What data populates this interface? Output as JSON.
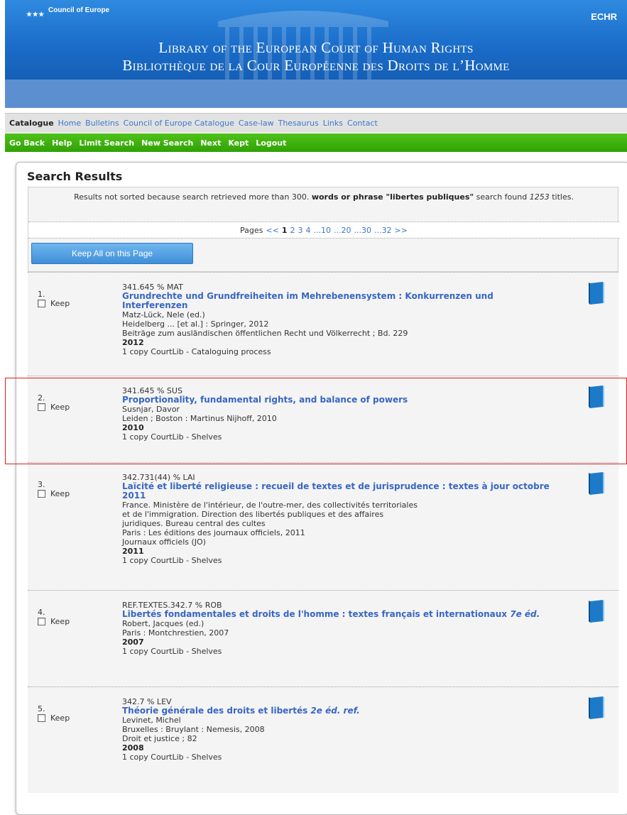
{
  "banner": {
    "org_name": "Council of Europe",
    "corner_label": "ECHR",
    "title_en": "Library of the European Court of Human Rights",
    "title_fr": "Bibliothèque de la Cour Européenne des Droits de l’Homme"
  },
  "main_nav": {
    "current": "Catalogue",
    "links": [
      "Home",
      "Bulletins",
      "Council of Europe Catalogue",
      "Case-law",
      "Thesaurus",
      "Links",
      "Contact"
    ]
  },
  "action_nav": [
    "Go Back",
    "Help",
    "Limit Search",
    "New Search",
    "Next",
    "Kept",
    "Logout"
  ],
  "results": {
    "heading": "Search Results",
    "sort_note_prefix": "Results not sorted because search retrieved more than 300.",
    "sort_note_query": "words or phrase \"libertes publiques\"",
    "sort_note_mid": "search found",
    "sort_note_count": "1253",
    "sort_note_suffix": "titles.",
    "pager": {
      "label": "Pages",
      "prev": "<<",
      "current": "1",
      "pages": [
        "2",
        "3",
        "4",
        "...10",
        "...20",
        "...30",
        "...32"
      ],
      "next": ">>"
    },
    "keep_all_label": "Keep All on this Page",
    "keep_label": "Keep",
    "records": [
      {
        "num": "1.",
        "call": "341.645 % MAT",
        "title": "Grundrechte und Grundfreiheiten im Mehrebenensystem : Konkurrenzen und Interferenzen",
        "edition": "",
        "lines": [
          "Matz-Lück, Nele (ed.)",
          "Heidelberg ... [et al.] : Springer, 2012",
          "Beiträge zum ausländischen öffentlichen Recht und Völkerrecht ; Bd. 229"
        ],
        "year": "2012",
        "holding": "1 copy CourtLib - Cataloguing process"
      },
      {
        "num": "2.",
        "call": "341.645 % SUS",
        "title": "Proportionality, fundamental rights, and balance of powers",
        "edition": "",
        "lines": [
          "Susnjar, Davor",
          "Leiden ; Boston : Martinus Nijhoff, 2010"
        ],
        "year": "2010",
        "holding": "1 copy CourtLib - Shelves"
      },
      {
        "num": "3.",
        "call": "342.731(44) % LAI",
        "title": "Laïcité et liberté religieuse : recueil de textes et de jurisprudence : textes à jour octobre 2011",
        "edition": "",
        "lines": [
          "France. Ministère de l'intérieur, de l'outre-mer, des collectivités territoriales",
          "et de l'immigration. Direction des libertés publiques et des affaires",
          "juridiques. Bureau central des cultes",
          "Paris : Les éditions des journaux officiels, 2011",
          "Journaux officiels (JO)"
        ],
        "year": "2011",
        "holding": "1 copy CourtLib - Shelves"
      },
      {
        "num": "4.",
        "call": "REF.TEXTES.342.7 % ROB",
        "title": "Libertés fondamentales et droits de l'homme : textes français et internationaux",
        "edition": "7e éd.",
        "lines": [
          "Robert, Jacques (ed.)",
          "Paris : Montchrestien, 2007"
        ],
        "year": "2007",
        "holding": "1 copy CourtLib - Shelves"
      },
      {
        "num": "5.",
        "call": "342.7 % LEV",
        "title": "Théorie générale des droits et libertés",
        "edition": "2e éd. ref.",
        "lines": [
          "Levinet, Michel",
          "Bruxelles : Bruylant : Nemesis, 2008",
          "Droit et justice ; 82"
        ],
        "year": "2008",
        "holding": "1 copy CourtLib - Shelves"
      }
    ]
  },
  "colors": {
    "banner_blue": "#1a6cc8",
    "nav_green": "#2fa203",
    "link_blue": "#3c78c8",
    "title_blue": "#3866c2",
    "highlight_red": "#e21b1b"
  }
}
